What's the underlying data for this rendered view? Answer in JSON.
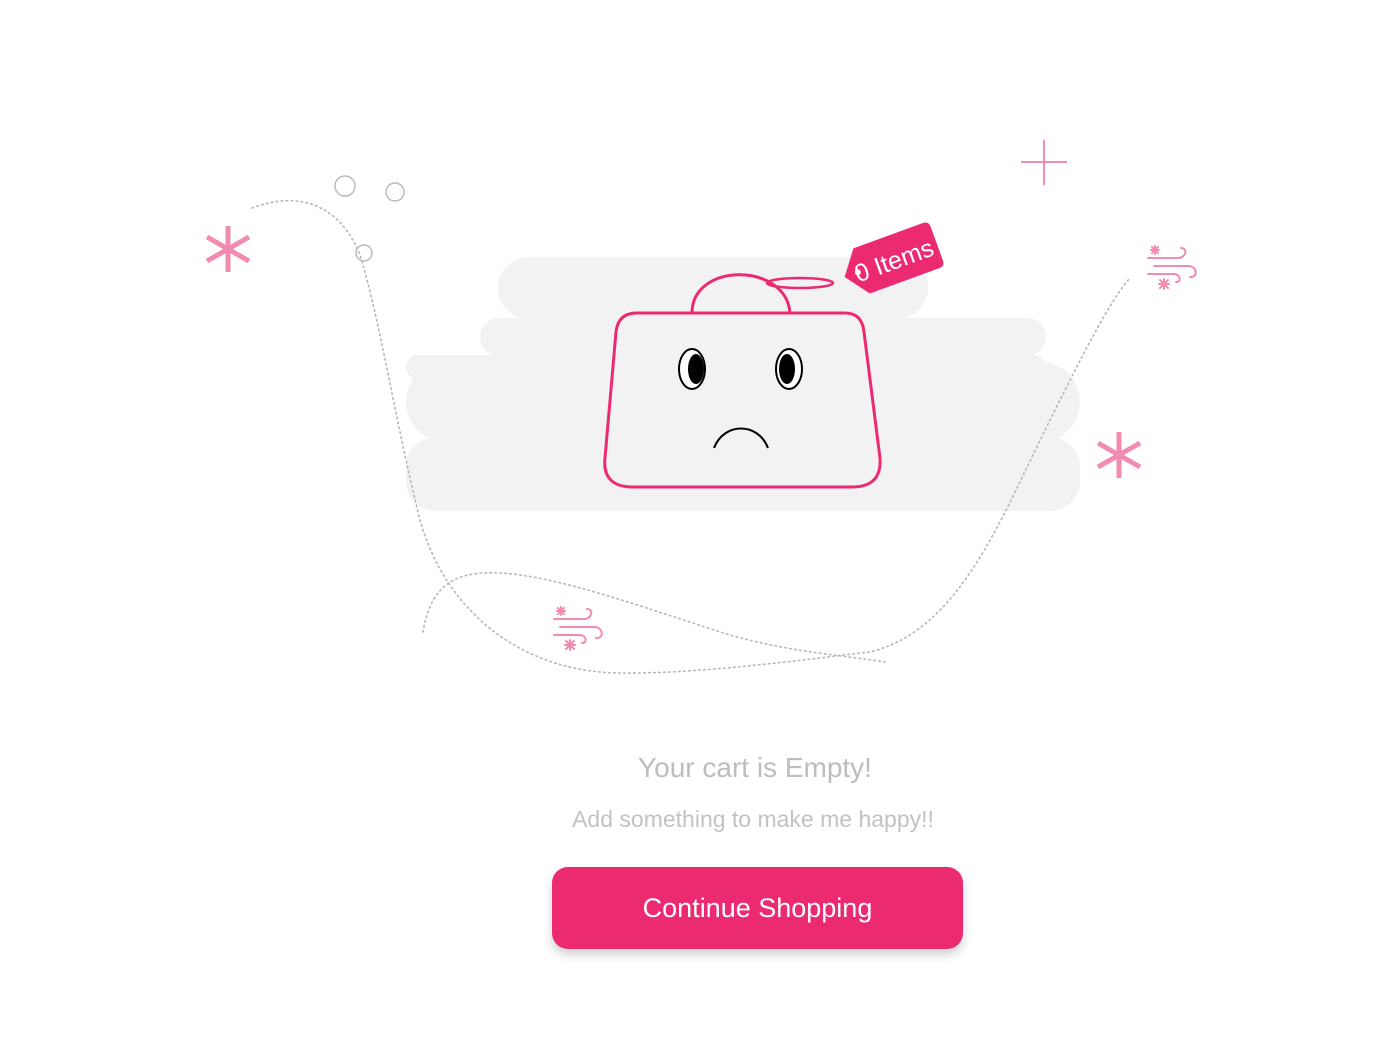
{
  "illustration": {
    "tag_label": "0 Items",
    "icons": [
      "asterisk-icon",
      "plus-icon",
      "wind-snow-icon",
      "bubble-icon",
      "sad-bag-icon"
    ]
  },
  "message": {
    "title": "Your cart is Empty!",
    "subtitle": "Add something to make me happy!!"
  },
  "actions": {
    "continue_label": "Continue Shopping"
  },
  "colors": {
    "accent": "#ec2a72",
    "accent_light": "#f28bb0",
    "cloud": "#f2f2f2",
    "text_muted": "#bdbdbd"
  }
}
